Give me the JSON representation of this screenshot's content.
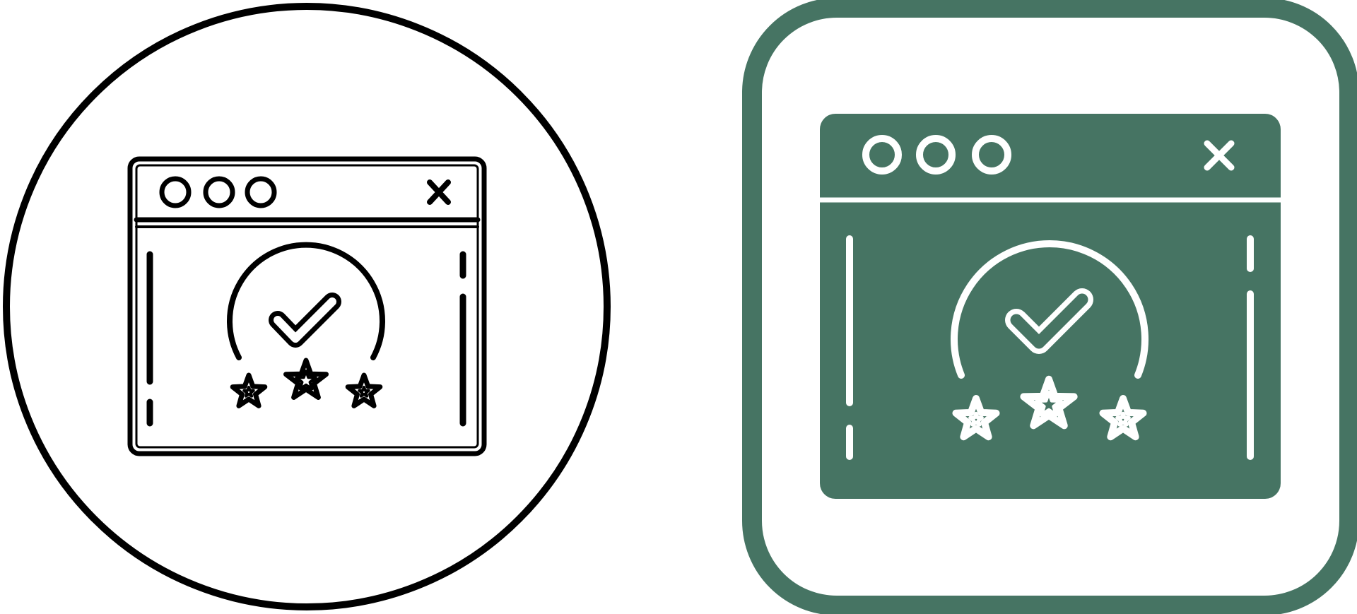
{
  "icons": [
    {
      "name": "website-rating-line-icon",
      "style": "outline",
      "frame_shape": "circle",
      "stroke_color": "#000000",
      "background_color": "#ffffff",
      "depicts": [
        "browser-window",
        "checkmark-badge",
        "three-stars"
      ]
    },
    {
      "name": "website-rating-glyph-icon",
      "style": "filled",
      "frame_shape": "rounded-square",
      "frame_color": "#467463",
      "fill_color": "#467463",
      "detail_color": "#ffffff",
      "depicts": [
        "browser-window",
        "checkmark-badge",
        "three-stars"
      ]
    }
  ]
}
